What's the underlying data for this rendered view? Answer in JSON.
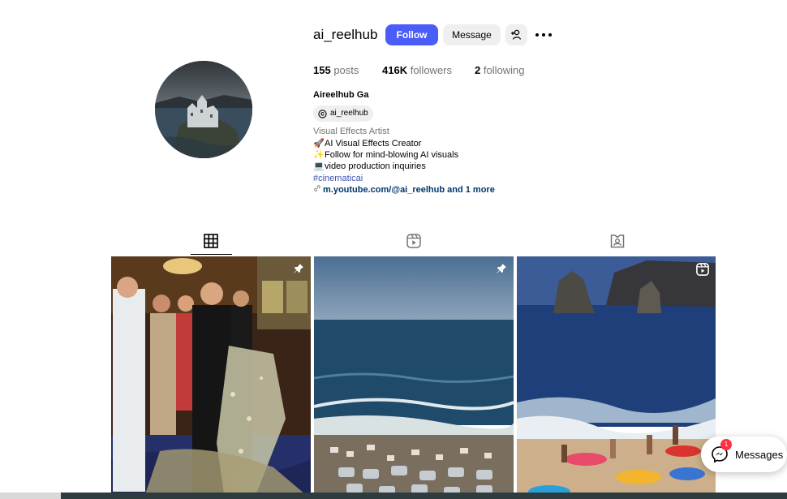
{
  "profile": {
    "username": "ai_reelhub",
    "follow_label": "Follow",
    "message_label": "Message",
    "stats": {
      "posts_count": "155",
      "posts_label": "posts",
      "followers_count": "416K",
      "followers_label": "followers",
      "following_count": "2",
      "following_label": "following"
    },
    "full_name": "Aireelhub Ga",
    "threads_handle": "ai_reelhub",
    "category": "Visual Effects Artist",
    "bio_lines": [
      {
        "emoji": "🚀",
        "text": "AI Visual Effects Creator"
      },
      {
        "emoji": "✨",
        "text": "Follow for mind-blowing AI visuals"
      },
      {
        "emoji": "💻",
        "text": "video production inquiries"
      }
    ],
    "hashtag": "#cinematicai",
    "link_text": "m.youtube.com/@ai_reelhub and 1 more"
  },
  "icons": {
    "add_user": "person-add-icon",
    "more": "more-horizontal-icon",
    "threads": "threads-icon",
    "link": "link-icon",
    "tab_posts": "grid-icon",
    "tab_reels": "reels-icon",
    "tab_tagged": "tagged-icon",
    "pin": "pin-icon",
    "reel_badge": "reel-icon",
    "messenger": "messenger-icon"
  },
  "messages": {
    "label": "Messages",
    "badge": "1"
  },
  "colors": {
    "follow_button": "#4a5df9",
    "secondary_button": "#efefef",
    "link": "#00376b",
    "hashtag": "#3f51b5",
    "badge": "#ff3040"
  }
}
